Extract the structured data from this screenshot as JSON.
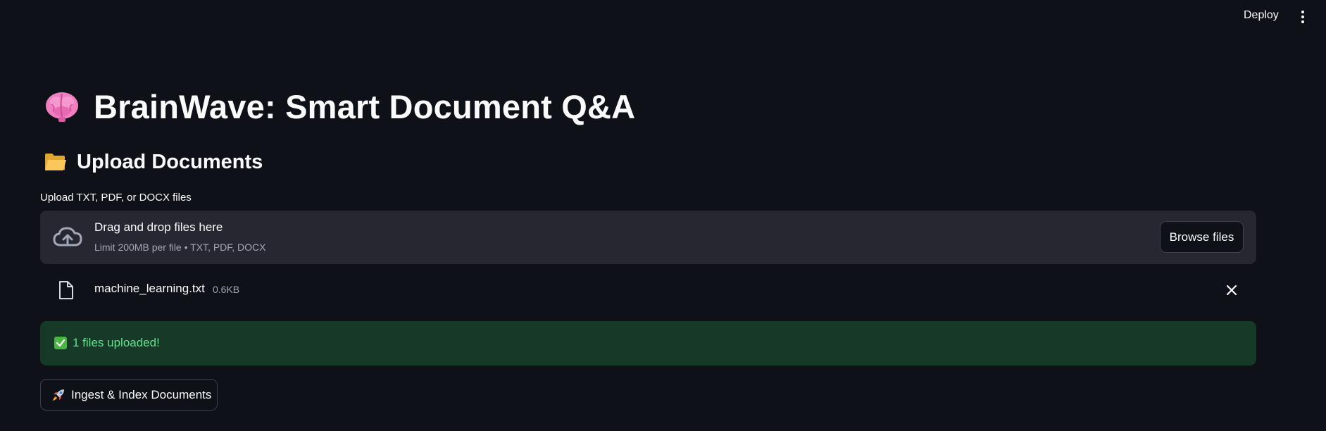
{
  "header": {
    "deploy_label": "Deploy",
    "menu_icon": "more-vertical-icon"
  },
  "page": {
    "title_icon": "brain-icon",
    "title": "BrainWave: Smart Document Q&A"
  },
  "upload_section": {
    "icon": "open-folder-icon",
    "title": "Upload Documents",
    "uploader_label": "Upload TXT, PDF, or DOCX files",
    "dropzone": {
      "icon": "cloud-upload-icon",
      "main_text": "Drag and drop files here",
      "sub_text": "Limit 200MB per file • TXT, PDF, DOCX",
      "browse_label": "Browse files"
    },
    "files": [
      {
        "icon": "file-icon",
        "name": "machine_learning.txt",
        "size": "0.6KB",
        "remove_icon": "close-icon"
      }
    ]
  },
  "alert": {
    "icon": "check-box-icon",
    "text": "1 files uploaded!"
  },
  "action": {
    "icon": "rocket-icon",
    "label": "Ingest & Index Documents"
  },
  "colors": {
    "background": "#0e1117",
    "surface": "#262730",
    "success_bg": "#173928",
    "success_text": "#5ce488",
    "muted_text": "#a3a8b8"
  }
}
